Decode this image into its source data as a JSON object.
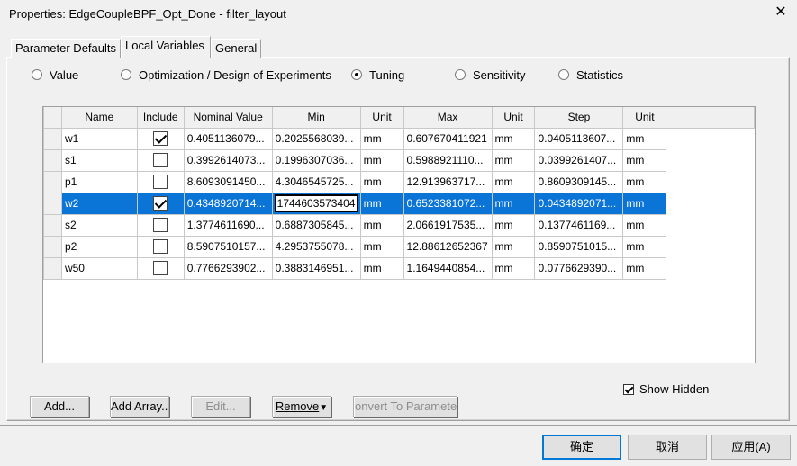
{
  "window": {
    "title": "Properties: EdgeCoupleBPF_Opt_Done - filter_layout",
    "close_glyph": "✕"
  },
  "tabs": [
    {
      "label": "Parameter Defaults",
      "active": false
    },
    {
      "label": "Local Variables",
      "active": true
    },
    {
      "label": "General",
      "active": false
    }
  ],
  "modes": [
    {
      "label": "Value",
      "selected": false
    },
    {
      "label": "Optimization / Design of Experiments",
      "selected": false
    },
    {
      "label": "Tuning",
      "selected": true
    },
    {
      "label": "Sensitivity",
      "selected": false
    },
    {
      "label": "Statistics",
      "selected": false
    }
  ],
  "grid": {
    "columns": [
      "Name",
      "Include",
      "Nominal Value",
      "Min",
      "Unit",
      "Max",
      "Unit",
      "Step",
      "Unit"
    ],
    "rows": [
      {
        "name": "w1",
        "include": true,
        "nominal": "0.4051136079...",
        "min": "0.2025568039...",
        "min_unit": "mm",
        "max": "0.607670411921",
        "max_unit": "mm",
        "step": "0.0405113607...",
        "step_unit": "mm",
        "selected": false
      },
      {
        "name": "s1",
        "include": false,
        "nominal": "0.3992614073...",
        "min": "0.1996307036...",
        "min_unit": "mm",
        "max": "0.5988921110...",
        "max_unit": "mm",
        "step": "0.0399261407...",
        "step_unit": "mm",
        "selected": false
      },
      {
        "name": "p1",
        "include": false,
        "nominal": "8.6093091450...",
        "min": "4.3046545725...",
        "min_unit": "mm",
        "max": "12.913963717...",
        "max_unit": "mm",
        "step": "0.8609309145...",
        "step_unit": "mm",
        "selected": false
      },
      {
        "name": "w2",
        "include": true,
        "nominal": "0.4348920714...",
        "min": "1744603573404",
        "min_unit": "mm",
        "max": "0.6523381072...",
        "max_unit": "mm",
        "step": "0.0434892071...",
        "step_unit": "mm",
        "selected": true
      },
      {
        "name": "s2",
        "include": false,
        "nominal": "1.3774611690...",
        "min": "0.6887305845...",
        "min_unit": "mm",
        "max": "2.0661917535...",
        "max_unit": "mm",
        "step": "0.1377461169...",
        "step_unit": "mm",
        "selected": false
      },
      {
        "name": "p2",
        "include": false,
        "nominal": "8.5907510157...",
        "min": "4.2953755078...",
        "min_unit": "mm",
        "max": "12.88612652367",
        "max_unit": "mm",
        "step": "0.8590751015...",
        "step_unit": "mm",
        "selected": false
      },
      {
        "name": "w50",
        "include": false,
        "nominal": "0.7766293902...",
        "min": "0.3883146951...",
        "min_unit": "mm",
        "max": "1.1649440854...",
        "max_unit": "mm",
        "step": "0.0776629390...",
        "step_unit": "mm",
        "selected": false
      }
    ]
  },
  "show_hidden": {
    "label": "Show Hidden",
    "checked": true
  },
  "actions": {
    "add": "Add...",
    "add_array": "Add Array...",
    "edit": "Edit...",
    "remove": "Remove",
    "remove_arrow": "▼",
    "convert": "onvert To Paramete"
  },
  "footer": {
    "ok": "确定",
    "cancel": "取消",
    "apply": "应用(A)"
  },
  "colors": {
    "selection": "#0a74d7",
    "dialog_bg": "#f0f0f0"
  }
}
